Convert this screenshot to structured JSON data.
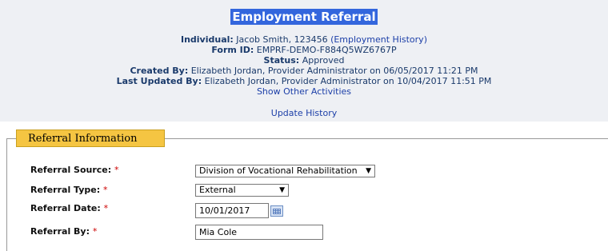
{
  "header": {
    "title": "Employment Referral",
    "individual_label": "Individual:",
    "individual_value": "Jacob Smith, 123456",
    "employment_history_link": "(Employment History)",
    "form_id_label": "Form ID:",
    "form_id_value": "EMPRF-DEMO-F884Q5WZ6767P",
    "status_label": "Status:",
    "status_value": "Approved",
    "created_by_label": "Created By:",
    "created_by_value": "Elizabeth Jordan, Provider Administrator on 06/05/2017 11:21 PM",
    "updated_by_label": "Last Updated By:",
    "updated_by_value": "Elizabeth Jordan, Provider Administrator on 10/04/2017 11:51 PM",
    "show_other_activities": "Show Other Activities",
    "update_history": "Update History"
  },
  "section": {
    "title": "Referral Information",
    "referral_source_label": "Referral Source:",
    "referral_source_value": "Division of Vocational Rehabilitation",
    "referral_type_label": "Referral Type:",
    "referral_type_value": "External",
    "referral_date_label": "Referral Date:",
    "referral_date_value": "10/01/2017",
    "referral_by_label": "Referral By:",
    "referral_by_value": "Mia Cole",
    "required_mark": "*"
  },
  "icons": {
    "dropdown": "▼",
    "calendar": "calendar-icon"
  },
  "colors": {
    "header_bg": "#eef0f4",
    "title_highlight": "#3366dd",
    "legend_bg": "#f5c542",
    "required": "#cc0000"
  }
}
